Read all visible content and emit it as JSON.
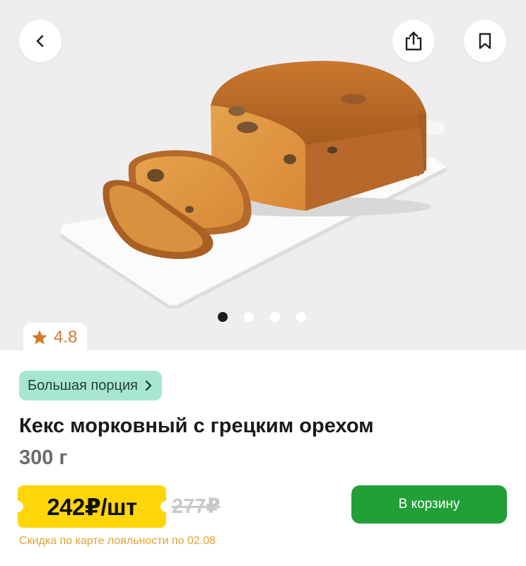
{
  "header": {
    "back_icon": "chevron-left-icon",
    "share_icon": "share-icon",
    "bookmark_icon": "bookmark-icon"
  },
  "gallery": {
    "image": "carrot-walnut-loaf-cake-photo",
    "slide_count": 4,
    "active_slide": 1
  },
  "rating": {
    "icon": "star-icon",
    "value": "4.8",
    "color": "#d1782b"
  },
  "portion_tag": {
    "label": "Большая порция",
    "icon": "chevron-right-icon",
    "color": "#a7e7cf"
  },
  "product": {
    "title": "Кекс морковный с грецким орехом",
    "weight": "300 г"
  },
  "price": {
    "current": "242₽/шт",
    "old": "277₽",
    "tag_color": "#ffd60a"
  },
  "cart_button": {
    "label": "В корзину",
    "color": "#21a038"
  },
  "discount_note": "Скидка по карте лояльности по 02.08"
}
